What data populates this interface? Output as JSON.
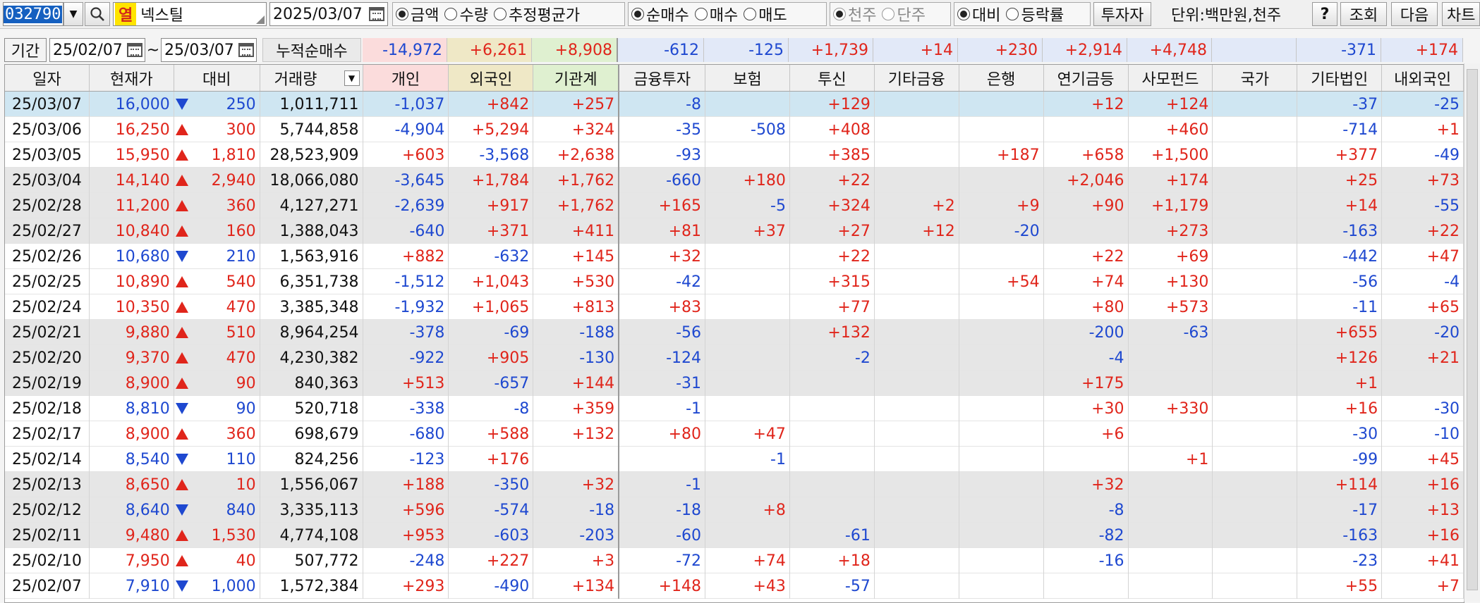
{
  "toolbar": {
    "stock_code": "032790",
    "stock_badge": "열",
    "stock_name": "넥스틸",
    "date": "2025/03/07",
    "value_type_options": [
      "금액",
      "수량",
      "추정평균가"
    ],
    "value_type_selected": 0,
    "trade_type_options": [
      "순매수",
      "매수",
      "매도"
    ],
    "trade_type_selected": 0,
    "unit_type_options": [
      "천주",
      "단주"
    ],
    "unit_type_selected": 0,
    "compare_options": [
      "대비",
      "등락률"
    ],
    "compare_selected": 0,
    "investor_button": "투자자",
    "unit_label": "단위:백만원,천주",
    "help_button": "?",
    "query_button": "조회",
    "next_button": "다음",
    "chart_button": "차트"
  },
  "period": {
    "label": "기간",
    "start": "25/02/07",
    "separator": "~",
    "end": "25/03/07",
    "cumulative_label": "누적순매수",
    "sums": [
      "-14,972",
      "+6,261",
      "+8,908",
      "-612",
      "-125",
      "+1,739",
      "+14",
      "+230",
      "+2,914",
      "+4,748",
      "",
      "-371",
      "+174"
    ]
  },
  "columns": [
    "일자",
    "현재가",
    "대비",
    "거래량",
    "개인",
    "외국인",
    "기관계",
    "금융투자",
    "보험",
    "투신",
    "기타금융",
    "은행",
    "연기금등",
    "사모펀드",
    "국가",
    "기타법인",
    "내외국인"
  ],
  "rows": [
    {
      "date": "25/03/07",
      "price": "16,000",
      "dir": "down",
      "diff": "250",
      "volume": "1,011,711",
      "v": [
        "-1,037",
        "+842",
        "+257",
        "-8",
        "",
        "+129",
        "",
        "",
        "+12",
        "+124",
        "",
        "-37",
        "-25"
      ]
    },
    {
      "date": "25/03/06",
      "price": "16,250",
      "dir": "up",
      "diff": "300",
      "volume": "5,744,858",
      "v": [
        "-4,904",
        "+5,294",
        "+324",
        "-35",
        "-508",
        "+408",
        "",
        "",
        "",
        "+460",
        "",
        "-714",
        "+1"
      ]
    },
    {
      "date": "25/03/05",
      "price": "15,950",
      "dir": "up",
      "diff": "1,810",
      "volume": "28,523,909",
      "v": [
        "+603",
        "-3,568",
        "+2,638",
        "-93",
        "",
        "+385",
        "",
        "+187",
        "+658",
        "+1,500",
        "",
        "+377",
        "-49"
      ]
    },
    {
      "date": "25/03/04",
      "price": "14,140",
      "dir": "up",
      "diff": "2,940",
      "volume": "18,066,080",
      "v": [
        "-3,645",
        "+1,784",
        "+1,762",
        "-660",
        "+180",
        "+22",
        "",
        "",
        "+2,046",
        "+174",
        "",
        "+25",
        "+73"
      ]
    },
    {
      "date": "25/02/28",
      "price": "11,200",
      "dir": "up",
      "diff": "360",
      "volume": "4,127,271",
      "v": [
        "-2,639",
        "+917",
        "+1,762",
        "+165",
        "-5",
        "+324",
        "+2",
        "+9",
        "+90",
        "+1,179",
        "",
        "+14",
        "-55"
      ]
    },
    {
      "date": "25/02/27",
      "price": "10,840",
      "dir": "up",
      "diff": "160",
      "volume": "1,388,043",
      "v": [
        "-640",
        "+371",
        "+411",
        "+81",
        "+37",
        "+27",
        "+12",
        "-20",
        "",
        "+273",
        "",
        "-163",
        "+22"
      ]
    },
    {
      "date": "25/02/26",
      "price": "10,680",
      "dir": "down",
      "diff": "210",
      "volume": "1,563,916",
      "v": [
        "+882",
        "-632",
        "+145",
        "+32",
        "",
        "+22",
        "",
        "",
        "+22",
        "+69",
        "",
        "-442",
        "+47"
      ]
    },
    {
      "date": "25/02/25",
      "price": "10,890",
      "dir": "up",
      "diff": "540",
      "volume": "6,351,738",
      "v": [
        "-1,512",
        "+1,043",
        "+530",
        "-42",
        "",
        "+315",
        "",
        "+54",
        "+74",
        "+130",
        "",
        "-56",
        "-4"
      ]
    },
    {
      "date": "25/02/24",
      "price": "10,350",
      "dir": "up",
      "diff": "470",
      "volume": "3,385,348",
      "v": [
        "-1,932",
        "+1,065",
        "+813",
        "+83",
        "",
        "+77",
        "",
        "",
        "+80",
        "+573",
        "",
        "-11",
        "+65"
      ]
    },
    {
      "date": "25/02/21",
      "price": "9,880",
      "dir": "up",
      "diff": "510",
      "volume": "8,964,254",
      "v": [
        "-378",
        "-69",
        "-188",
        "-56",
        "",
        "+132",
        "",
        "",
        "-200",
        "-63",
        "",
        "+655",
        "-20"
      ]
    },
    {
      "date": "25/02/20",
      "price": "9,370",
      "dir": "up",
      "diff": "470",
      "volume": "4,230,382",
      "v": [
        "-922",
        "+905",
        "-130",
        "-124",
        "",
        "-2",
        "",
        "",
        "-4",
        "",
        "",
        "+126",
        "+21"
      ]
    },
    {
      "date": "25/02/19",
      "price": "8,900",
      "dir": "up",
      "diff": "90",
      "volume": "840,363",
      "v": [
        "+513",
        "-657",
        "+144",
        "-31",
        "",
        "",
        "",
        "",
        "+175",
        "",
        "",
        "+1",
        ""
      ]
    },
    {
      "date": "25/02/18",
      "price": "8,810",
      "dir": "down",
      "diff": "90",
      "volume": "520,718",
      "v": [
        "-338",
        "-8",
        "+359",
        "-1",
        "",
        "",
        "",
        "",
        "+30",
        "+330",
        "",
        "+16",
        "-30"
      ]
    },
    {
      "date": "25/02/17",
      "price": "8,900",
      "dir": "up",
      "diff": "360",
      "volume": "698,679",
      "v": [
        "-680",
        "+588",
        "+132",
        "+80",
        "+47",
        "",
        "",
        "",
        "+6",
        "",
        "",
        "-30",
        "-10"
      ]
    },
    {
      "date": "25/02/14",
      "price": "8,540",
      "dir": "down",
      "diff": "110",
      "volume": "824,256",
      "v": [
        "-123",
        "+176",
        "",
        "",
        "-1",
        "",
        "",
        "",
        "",
        "+1",
        "",
        "-99",
        "+45"
      ]
    },
    {
      "date": "25/02/13",
      "price": "8,650",
      "dir": "up",
      "diff": "10",
      "volume": "1,556,067",
      "v": [
        "+188",
        "-350",
        "+32",
        "-1",
        "",
        "",
        "",
        "",
        "+32",
        "",
        "",
        "+114",
        "+16"
      ]
    },
    {
      "date": "25/02/12",
      "price": "8,640",
      "dir": "down",
      "diff": "840",
      "volume": "3,335,113",
      "v": [
        "+596",
        "-574",
        "-18",
        "-18",
        "+8",
        "",
        "",
        "",
        "-8",
        "",
        "",
        "-17",
        "+13"
      ]
    },
    {
      "date": "25/02/11",
      "price": "9,480",
      "dir": "up",
      "diff": "1,530",
      "volume": "4,774,108",
      "v": [
        "+953",
        "-603",
        "-203",
        "-60",
        "",
        "-61",
        "",
        "",
        "-82",
        "",
        "",
        "-163",
        "+16"
      ]
    },
    {
      "date": "25/02/10",
      "price": "7,950",
      "dir": "up",
      "diff": "40",
      "volume": "507,772",
      "v": [
        "-248",
        "+227",
        "+3",
        "-72",
        "+74",
        "+18",
        "",
        "",
        "-16",
        "",
        "",
        "-23",
        "+41"
      ]
    },
    {
      "date": "25/02/07",
      "price": "7,910",
      "dir": "down",
      "diff": "1,000",
      "volume": "1,572,384",
      "v": [
        "+293",
        "-490",
        "+134",
        "+148",
        "+43",
        "-57",
        "",
        "",
        "",
        "",
        "",
        "+55",
        "+7"
      ]
    }
  ],
  "colors": {
    "up": "#e0251b",
    "down": "#1e48d0",
    "selected_row": "#cfe6f2",
    "shaded_row": "#e6e6e6",
    "sum_individual": "#fbdcdc",
    "sum_foreign": "#efe8c6",
    "sum_inst": "#dff0d0",
    "sum_rest": "#e2e9f8"
  }
}
